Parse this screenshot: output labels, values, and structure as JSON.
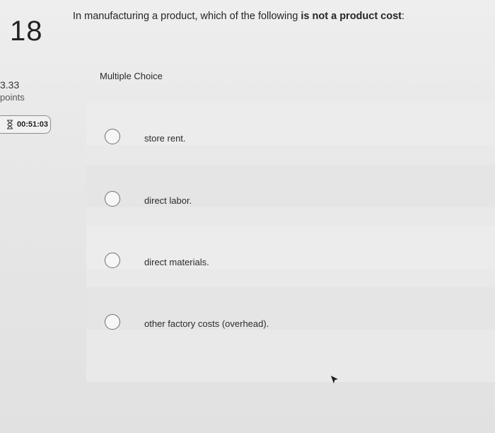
{
  "question": {
    "number": "18",
    "text_before": "In manufacturing a product, which of the following ",
    "text_bold": "is not a product cost",
    "text_after": ":",
    "type": "Multiple Choice"
  },
  "sidebar": {
    "points_value": "3.33",
    "points_label": "points",
    "timer": "00:51:03"
  },
  "choices": [
    {
      "label": "store rent."
    },
    {
      "label": "direct labor."
    },
    {
      "label": "direct materials."
    },
    {
      "label": "other factory costs (overhead)."
    }
  ],
  "icons": {
    "timer": "hourglass-icon",
    "radio": "radio-circle",
    "cursor": "mouse-pointer-icon"
  }
}
